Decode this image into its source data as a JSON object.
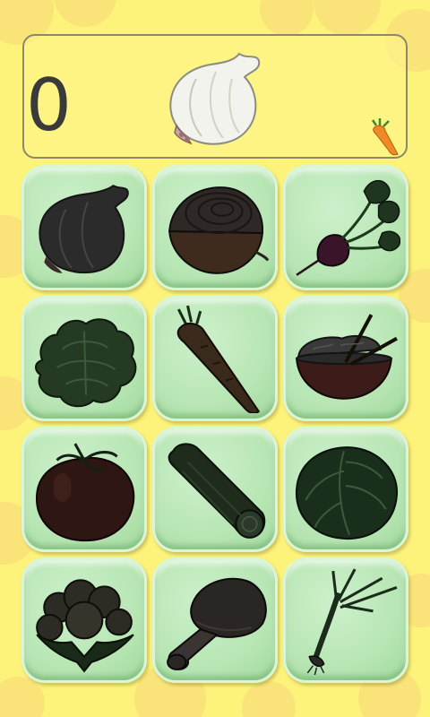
{
  "game": {
    "score": "0",
    "target_item": "garlic",
    "colors": {
      "background": "#fdf27a",
      "tile": "#b8e6b4",
      "silhouette": "#2b2b2b"
    },
    "lives_icon": "carrot-icon",
    "tiles": [
      {
        "name": "garlic"
      },
      {
        "name": "onion"
      },
      {
        "name": "beet"
      },
      {
        "name": "lettuce"
      },
      {
        "name": "carrot"
      },
      {
        "name": "rice-bowl"
      },
      {
        "name": "tomato"
      },
      {
        "name": "cucumber"
      },
      {
        "name": "cabbage"
      },
      {
        "name": "cauliflower"
      },
      {
        "name": "mushroom"
      },
      {
        "name": "leek"
      }
    ]
  }
}
